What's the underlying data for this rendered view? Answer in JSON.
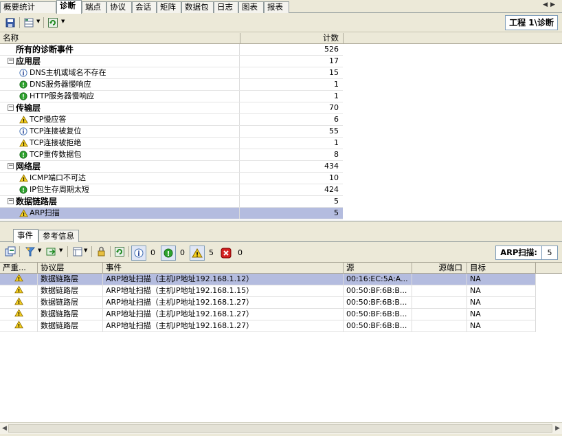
{
  "tabs": [
    "概要统计",
    "诊断",
    "端点",
    "协议",
    "会话",
    "矩阵",
    "数据包",
    "日志",
    "图表",
    "报表"
  ],
  "active_tab": "诊断",
  "toolbar": {
    "breadcrumb": "工程 1\\诊断"
  },
  "diag_grid": {
    "columns": {
      "name": "名称",
      "count": "计数"
    },
    "rows": [
      {
        "label": "所有的诊断事件",
        "count": "526",
        "level": 0,
        "kind": "total",
        "icon": ""
      },
      {
        "label": "应用层",
        "count": "17",
        "level": 0,
        "kind": "group",
        "icon": ""
      },
      {
        "label": "DNS主机或域名不存在",
        "count": "15",
        "level": 1,
        "kind": "item",
        "icon": "info-icon"
      },
      {
        "label": "DNS服务器慢响应",
        "count": "1",
        "level": 1,
        "kind": "item",
        "icon": "notice-icon"
      },
      {
        "label": "HTTP服务器慢响应",
        "count": "1",
        "level": 1,
        "kind": "item",
        "icon": "notice-icon"
      },
      {
        "label": "传输层",
        "count": "70",
        "level": 0,
        "kind": "group",
        "icon": ""
      },
      {
        "label": "TCP慢应答",
        "count": "6",
        "level": 1,
        "kind": "item",
        "icon": "warning-icon"
      },
      {
        "label": "TCP连接被复位",
        "count": "55",
        "level": 1,
        "kind": "item",
        "icon": "info-icon"
      },
      {
        "label": "TCP连接被拒绝",
        "count": "1",
        "level": 1,
        "kind": "item",
        "icon": "warning-icon"
      },
      {
        "label": "TCP重传数据包",
        "count": "8",
        "level": 1,
        "kind": "item",
        "icon": "notice-icon"
      },
      {
        "label": "网络层",
        "count": "434",
        "level": 0,
        "kind": "group",
        "icon": ""
      },
      {
        "label": "ICMP端口不可达",
        "count": "10",
        "level": 1,
        "kind": "item",
        "icon": "warning-icon"
      },
      {
        "label": "IP包生存周期太短",
        "count": "424",
        "level": 1,
        "kind": "item",
        "icon": "notice-icon"
      },
      {
        "label": "数据链路层",
        "count": "5",
        "level": 0,
        "kind": "group",
        "icon": ""
      },
      {
        "label": "ARP扫描",
        "count": "5",
        "level": 1,
        "kind": "item",
        "icon": "warning-icon",
        "selected": true
      }
    ]
  },
  "lower_tabs": [
    "事件",
    "参考信息"
  ],
  "active_lower_tab": "事件",
  "event_toolbar": {
    "info_count": "0",
    "notice_count": "0",
    "warning_count": "5",
    "error_count": "0",
    "filter_label": "ARP扫描:",
    "filter_value": "5"
  },
  "event_grid": {
    "columns": [
      "严重...",
      "协议层",
      "事件",
      "源",
      "源端口",
      "目标"
    ],
    "rows": [
      {
        "severity": "warning-icon",
        "layer": "数据链路层",
        "event": "ARP地址扫描（主机IP地址192.168.1.12）",
        "source": "00:16:EC:5A:A...",
        "sport": "",
        "target": "NA",
        "selected": true
      },
      {
        "severity": "warning-icon",
        "layer": "数据链路层",
        "event": "ARP地址扫描（主机IP地址192.168.1.15）",
        "source": "00:50:BF:6B:B...",
        "sport": "",
        "target": "NA"
      },
      {
        "severity": "warning-icon",
        "layer": "数据链路层",
        "event": "ARP地址扫描（主机IP地址192.168.1.27）",
        "source": "00:50:BF:6B:B...",
        "sport": "",
        "target": "NA"
      },
      {
        "severity": "warning-icon",
        "layer": "数据链路层",
        "event": "ARP地址扫描（主机IP地址192.168.1.27）",
        "source": "00:50:BF:6B:B...",
        "sport": "",
        "target": "NA"
      },
      {
        "severity": "warning-icon",
        "layer": "数据链路层",
        "event": "ARP地址扫描（主机IP地址192.168.1.27）",
        "source": "00:50:BF:6B:B...",
        "sport": "",
        "target": "NA"
      }
    ]
  }
}
